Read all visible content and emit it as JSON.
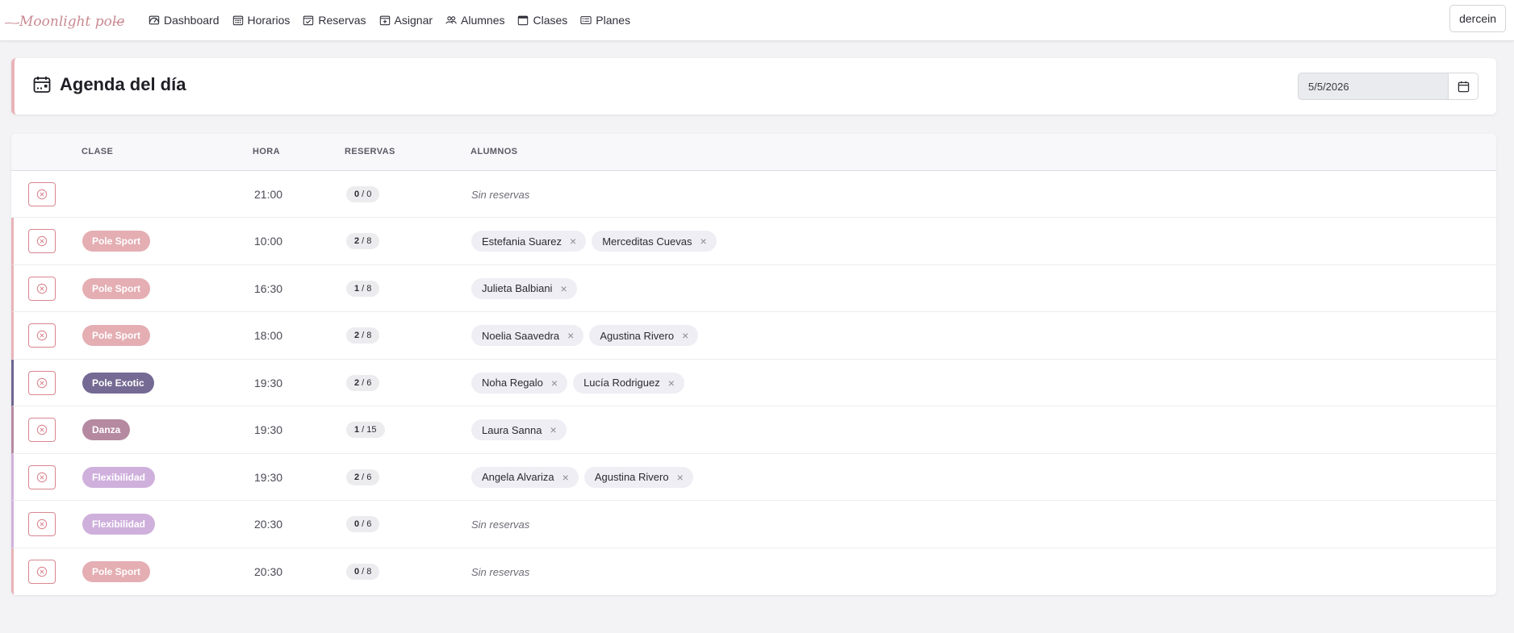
{
  "app": {
    "logo_text": "Moonlight pole",
    "user_button": "dercein"
  },
  "nav": [
    {
      "label": "Dashboard",
      "icon": "speedometer-icon"
    },
    {
      "label": "Horarios",
      "icon": "calendar-grid-icon"
    },
    {
      "label": "Reservas",
      "icon": "calendar-check-icon"
    },
    {
      "label": "Asignar",
      "icon": "calendar-plus-icon"
    },
    {
      "label": "Alumnes",
      "icon": "people-icon"
    },
    {
      "label": "Clases",
      "icon": "calendar-icon"
    },
    {
      "label": "Planes",
      "icon": "card-list-icon"
    }
  ],
  "agenda": {
    "title": "Agenda del día",
    "date_value": "5/5/2026"
  },
  "table": {
    "headers": {
      "clase": "CLASE",
      "hora": "HORA",
      "reservas": "RESERVAS",
      "alumnos": "ALUMNOS"
    },
    "empty_text": "Sin reservas",
    "rows": [
      {
        "clase": "",
        "hora": "21:00",
        "booked": "0",
        "capacity": "0",
        "accent": "",
        "pill_color": "",
        "alumnos": []
      },
      {
        "clase": "Pole Sport",
        "hora": "10:00",
        "booked": "2",
        "capacity": "8",
        "accent": "#e8b4b8",
        "pill_color": "#e4aeb3",
        "alumnos": [
          "Estefania Suarez",
          "Merceditas Cuevas"
        ]
      },
      {
        "clase": "Pole Sport",
        "hora": "16:30",
        "booked": "1",
        "capacity": "8",
        "accent": "#e8b4b8",
        "pill_color": "#e4aeb3",
        "alumnos": [
          "Julieta Balbiani"
        ]
      },
      {
        "clase": "Pole Sport",
        "hora": "18:00",
        "booked": "2",
        "capacity": "8",
        "accent": "#e8b4b8",
        "pill_color": "#e4aeb3",
        "alumnos": [
          "Noelia Saavedra",
          "Agustina Rivero"
        ]
      },
      {
        "clase": "Pole Exotic",
        "hora": "19:30",
        "booked": "2",
        "capacity": "6",
        "accent": "#6f6591",
        "pill_color": "#746a93",
        "alumnos": [
          "Noha Regalo",
          "Lucía Rodriguez"
        ]
      },
      {
        "clase": "Danza",
        "hora": "19:30",
        "booked": "1",
        "capacity": "15",
        "accent": "#b98aa3",
        "pill_color": "#b58aa1",
        "alumnos": [
          "Laura Sanna"
        ]
      },
      {
        "clase": "Flexibilidad",
        "hora": "19:30",
        "booked": "2",
        "capacity": "6",
        "accent": "#d0b1dc",
        "pill_color": "#cfb0dc",
        "alumnos": [
          "Angela Alvariza",
          "Agustina Rivero"
        ]
      },
      {
        "clase": "Flexibilidad",
        "hora": "20:30",
        "booked": "0",
        "capacity": "6",
        "accent": "#d0b1dc",
        "pill_color": "#cfb0dc",
        "alumnos": []
      },
      {
        "clase": "Pole Sport",
        "hora": "20:30",
        "booked": "0",
        "capacity": "8",
        "accent": "#e8b4b8",
        "pill_color": "#e4aeb3",
        "alumnos": []
      }
    ]
  }
}
